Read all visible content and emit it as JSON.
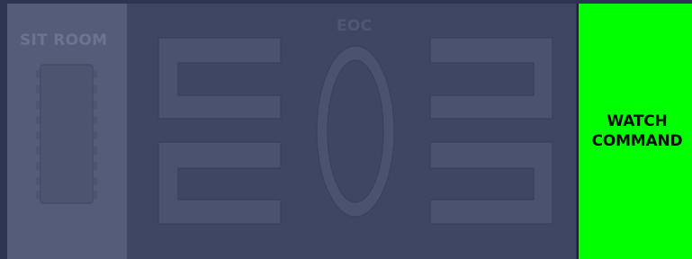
{
  "rooms": {
    "sit_room": {
      "label": "SIT ROOM"
    },
    "eoc": {
      "label": "EOC"
    },
    "watch_command": {
      "label": "WATCH\nCOMMAND",
      "color": "#00ff00"
    }
  },
  "colors": {
    "background": "#2c3552",
    "sit_room_fill": "#555c79",
    "eoc_fill": "#3f4663",
    "furniture": "#4b526f",
    "furniture_stroke": "#394060"
  }
}
